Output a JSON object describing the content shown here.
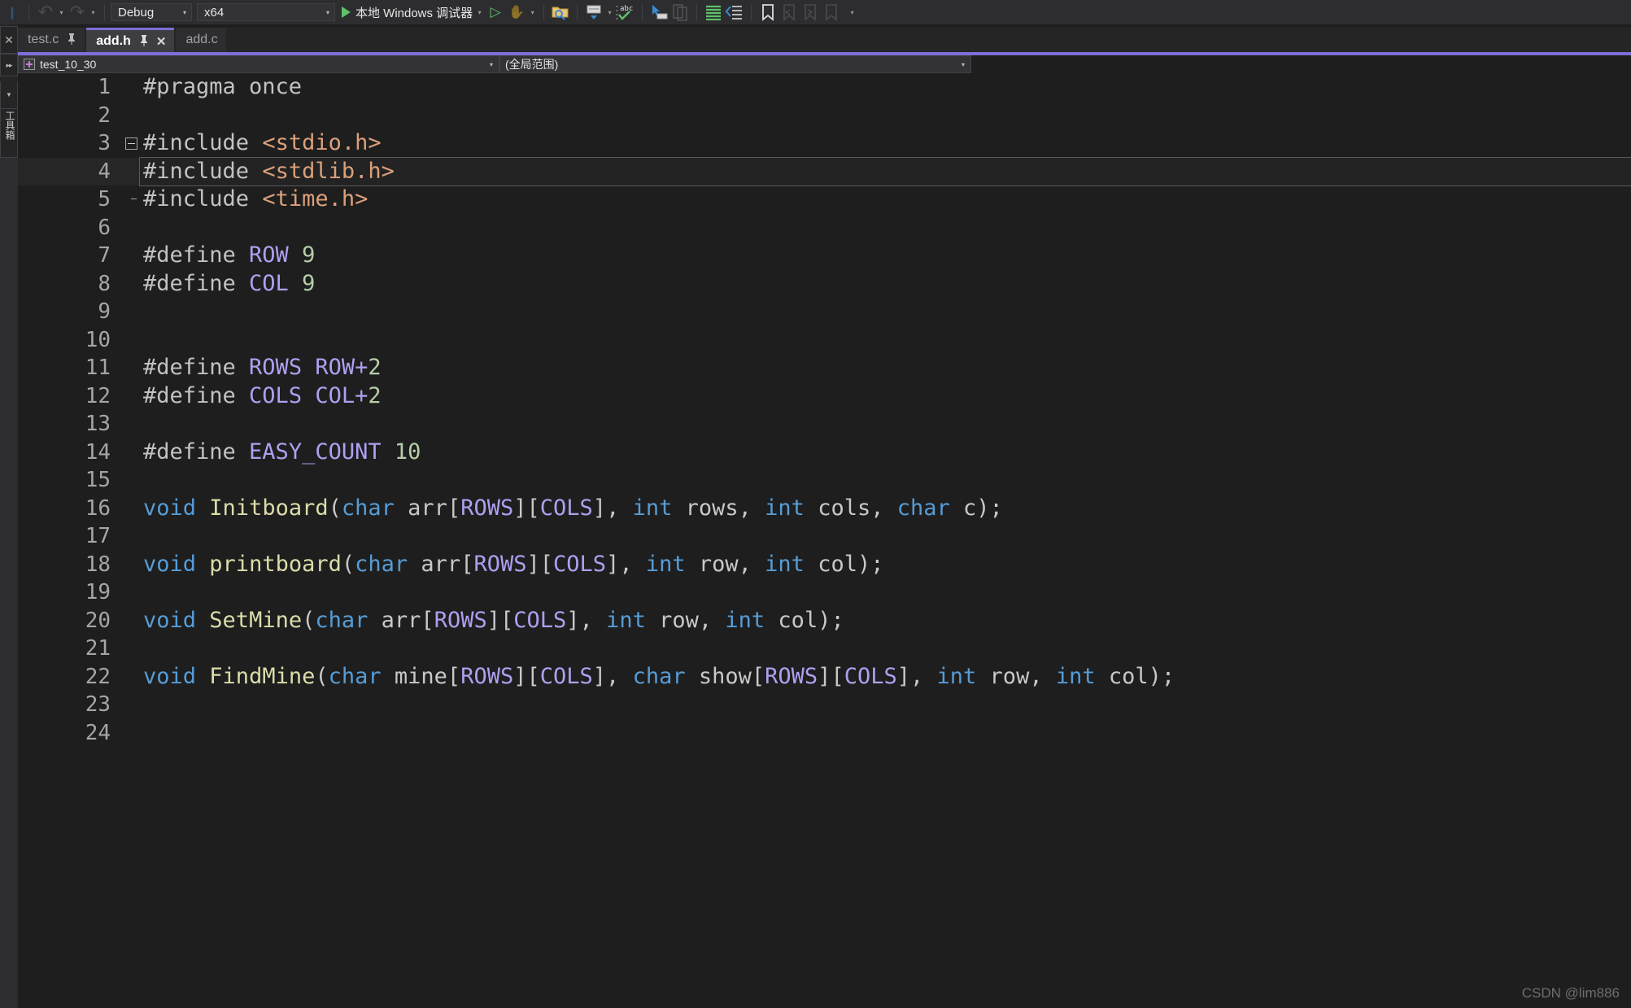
{
  "toolbar": {
    "undo_label": "↶",
    "undo_caret": "▾",
    "redo_label": "↷",
    "redo_caret": "▾",
    "config_value": "Debug",
    "config_arrow": "▾",
    "platform_value": "x64",
    "platform_arrow": "▾",
    "run_label": "本地 Windows 调试器",
    "run_caret": "▾",
    "start_no_debug_label": "▷",
    "stop_label": "✋",
    "stop_caret": "▾",
    "icons": [
      "find-in-files-icon",
      "comment-block-icon",
      "uncomment-caret-icon",
      "spellcheck-abc-icon",
      "indent-icon",
      "outdent-icon",
      "increase-indent-icon",
      "decrease-indent-icon",
      "toggle-bookmark-icon",
      "previous-bookmark-icon",
      "next-bookmark-icon",
      "clear-bookmarks-icon",
      "toolbar-overflow-icon"
    ]
  },
  "left_rail": {
    "close_glyph": "✕",
    "expand_glyph": "▸▸",
    "dropdown_glyph": "▼",
    "vertical_label": "工具箱"
  },
  "tabs": [
    {
      "label": "test.c",
      "pin": "📌",
      "active": false,
      "closable": false
    },
    {
      "label": "add.h",
      "pin": "📌",
      "active": true,
      "closable": true,
      "close": "✕"
    },
    {
      "label": "add.c",
      "pin": "",
      "active": false,
      "closable": false
    }
  ],
  "navbar": {
    "scope": "test_10_30",
    "scope_arrow": "▾",
    "member": "(全局范围)",
    "member_arrow": "▾"
  },
  "watermark": "CSDN @lim886",
  "editor": {
    "filename": "add.h",
    "current_line": 4,
    "total_lines": 24,
    "lines": [
      {
        "n": "1",
        "fold": "none",
        "tokens": [
          {
            "t": "#pragma once",
            "c": "c-pp"
          }
        ]
      },
      {
        "n": "2",
        "fold": "none",
        "tokens": []
      },
      {
        "n": "3",
        "fold": "start",
        "tokens": [
          {
            "t": "#include ",
            "c": "c-pp"
          },
          {
            "t": "<stdio.h>",
            "c": "c-str"
          }
        ]
      },
      {
        "n": "4",
        "fold": "mid",
        "tokens": [
          {
            "t": "#include ",
            "c": "c-pp"
          },
          {
            "t": "<stdlib.h>",
            "c": "c-str"
          }
        ]
      },
      {
        "n": "5",
        "fold": "end",
        "tokens": [
          {
            "t": "#include ",
            "c": "c-pp"
          },
          {
            "t": "<time.h>",
            "c": "c-str"
          }
        ]
      },
      {
        "n": "6",
        "fold": "none",
        "tokens": []
      },
      {
        "n": "7",
        "fold": "none",
        "tokens": [
          {
            "t": "#define ",
            "c": "c-pp"
          },
          {
            "t": "ROW",
            "c": "c-macro"
          },
          {
            "t": " ",
            "c": "c-plain"
          },
          {
            "t": "9",
            "c": "c-num"
          }
        ]
      },
      {
        "n": "8",
        "fold": "none",
        "tokens": [
          {
            "t": "#define ",
            "c": "c-pp"
          },
          {
            "t": "COL",
            "c": "c-macro"
          },
          {
            "t": " ",
            "c": "c-plain"
          },
          {
            "t": "9",
            "c": "c-num"
          }
        ]
      },
      {
        "n": "9",
        "fold": "none",
        "tokens": []
      },
      {
        "n": "10",
        "fold": "none",
        "tokens": []
      },
      {
        "n": "11",
        "fold": "none",
        "tokens": [
          {
            "t": "#define ",
            "c": "c-pp"
          },
          {
            "t": "ROWS ROW",
            "c": "c-macro"
          },
          {
            "t": "+",
            "c": "c-macro"
          },
          {
            "t": "2",
            "c": "c-num"
          }
        ]
      },
      {
        "n": "12",
        "fold": "none",
        "tokens": [
          {
            "t": "#define ",
            "c": "c-pp"
          },
          {
            "t": "COLS COL",
            "c": "c-macro"
          },
          {
            "t": "+",
            "c": "c-macro"
          },
          {
            "t": "2",
            "c": "c-num"
          }
        ]
      },
      {
        "n": "13",
        "fold": "none",
        "tokens": []
      },
      {
        "n": "14",
        "fold": "none",
        "tokens": [
          {
            "t": "#define ",
            "c": "c-pp"
          },
          {
            "t": "EASY_COUNT",
            "c": "c-macro"
          },
          {
            "t": " ",
            "c": "c-plain"
          },
          {
            "t": "10",
            "c": "c-num"
          }
        ]
      },
      {
        "n": "15",
        "fold": "none",
        "tokens": []
      },
      {
        "n": "16",
        "fold": "none",
        "tokens": [
          {
            "t": "void",
            "c": "c-kw"
          },
          {
            "t": " ",
            "c": "c-plain"
          },
          {
            "t": "Initboard",
            "c": "c-fn"
          },
          {
            "t": "(",
            "c": "c-punct"
          },
          {
            "t": "char",
            "c": "c-kw"
          },
          {
            "t": " arr",
            "c": "c-plain"
          },
          {
            "t": "[",
            "c": "c-punct"
          },
          {
            "t": "ROWS",
            "c": "c-macro"
          },
          {
            "t": "]",
            "c": "c-punct"
          },
          {
            "t": "[",
            "c": "c-punct"
          },
          {
            "t": "COLS",
            "c": "c-macro"
          },
          {
            "t": "]",
            "c": "c-punct"
          },
          {
            "t": ", ",
            "c": "c-plain"
          },
          {
            "t": "int",
            "c": "c-kw"
          },
          {
            "t": " rows, ",
            "c": "c-plain"
          },
          {
            "t": "int",
            "c": "c-kw"
          },
          {
            "t": " cols, ",
            "c": "c-plain"
          },
          {
            "t": "char",
            "c": "c-kw"
          },
          {
            "t": " c);",
            "c": "c-plain"
          }
        ]
      },
      {
        "n": "17",
        "fold": "none",
        "tokens": []
      },
      {
        "n": "18",
        "fold": "none",
        "tokens": [
          {
            "t": "void",
            "c": "c-kw"
          },
          {
            "t": " ",
            "c": "c-plain"
          },
          {
            "t": "printboard",
            "c": "c-fn"
          },
          {
            "t": "(",
            "c": "c-punct"
          },
          {
            "t": "char",
            "c": "c-kw"
          },
          {
            "t": " arr",
            "c": "c-plain"
          },
          {
            "t": "[",
            "c": "c-punct"
          },
          {
            "t": "ROWS",
            "c": "c-macro"
          },
          {
            "t": "]",
            "c": "c-punct"
          },
          {
            "t": "[",
            "c": "c-punct"
          },
          {
            "t": "COLS",
            "c": "c-macro"
          },
          {
            "t": "]",
            "c": "c-punct"
          },
          {
            "t": ", ",
            "c": "c-plain"
          },
          {
            "t": "int",
            "c": "c-kw"
          },
          {
            "t": " row, ",
            "c": "c-plain"
          },
          {
            "t": "int",
            "c": "c-kw"
          },
          {
            "t": " col);",
            "c": "c-plain"
          }
        ]
      },
      {
        "n": "19",
        "fold": "none",
        "tokens": []
      },
      {
        "n": "20",
        "fold": "none",
        "tokens": [
          {
            "t": "void",
            "c": "c-kw"
          },
          {
            "t": " ",
            "c": "c-plain"
          },
          {
            "t": "SetMine",
            "c": "c-fn"
          },
          {
            "t": "(",
            "c": "c-punct"
          },
          {
            "t": "char",
            "c": "c-kw"
          },
          {
            "t": " arr",
            "c": "c-plain"
          },
          {
            "t": "[",
            "c": "c-punct"
          },
          {
            "t": "ROWS",
            "c": "c-macro"
          },
          {
            "t": "]",
            "c": "c-punct"
          },
          {
            "t": "[",
            "c": "c-punct"
          },
          {
            "t": "COLS",
            "c": "c-macro"
          },
          {
            "t": "]",
            "c": "c-punct"
          },
          {
            "t": ", ",
            "c": "c-plain"
          },
          {
            "t": "int",
            "c": "c-kw"
          },
          {
            "t": " row, ",
            "c": "c-plain"
          },
          {
            "t": "int",
            "c": "c-kw"
          },
          {
            "t": " col);",
            "c": "c-plain"
          }
        ]
      },
      {
        "n": "21",
        "fold": "none",
        "tokens": []
      },
      {
        "n": "22",
        "fold": "none",
        "tokens": [
          {
            "t": "void",
            "c": "c-kw"
          },
          {
            "t": " ",
            "c": "c-plain"
          },
          {
            "t": "FindMine",
            "c": "c-fn"
          },
          {
            "t": "(",
            "c": "c-punct"
          },
          {
            "t": "char",
            "c": "c-kw"
          },
          {
            "t": " mine",
            "c": "c-plain"
          },
          {
            "t": "[",
            "c": "c-punct"
          },
          {
            "t": "ROWS",
            "c": "c-macro"
          },
          {
            "t": "]",
            "c": "c-punct"
          },
          {
            "t": "[",
            "c": "c-punct"
          },
          {
            "t": "COLS",
            "c": "c-macro"
          },
          {
            "t": "]",
            "c": "c-punct"
          },
          {
            "t": ", ",
            "c": "c-plain"
          },
          {
            "t": "char",
            "c": "c-kw"
          },
          {
            "t": " show",
            "c": "c-plain"
          },
          {
            "t": "[",
            "c": "c-punct"
          },
          {
            "t": "ROWS",
            "c": "c-macro"
          },
          {
            "t": "]",
            "c": "c-punct"
          },
          {
            "t": "[",
            "c": "c-punct"
          },
          {
            "t": "COLS",
            "c": "c-macro"
          },
          {
            "t": "]",
            "c": "c-punct"
          },
          {
            "t": ", ",
            "c": "c-plain"
          },
          {
            "t": "int",
            "c": "c-kw"
          },
          {
            "t": " row, ",
            "c": "c-plain"
          },
          {
            "t": "int",
            "c": "c-kw"
          },
          {
            "t": " col);",
            "c": "c-plain"
          }
        ]
      },
      {
        "n": "23",
        "fold": "none",
        "tokens": []
      },
      {
        "n": "24",
        "fold": "none",
        "tokens": []
      }
    ]
  },
  "colors": {
    "accent_purple": "#7c6fd8",
    "toolbar_bg": "#2d2d30",
    "editor_bg": "#1e1e1e",
    "keyword_blue": "#569cd6",
    "function_yellow": "#dcdcaa",
    "macro_violet": "#b09ff0",
    "string_orange": "#dba07a",
    "number_green": "#b5cea8"
  }
}
